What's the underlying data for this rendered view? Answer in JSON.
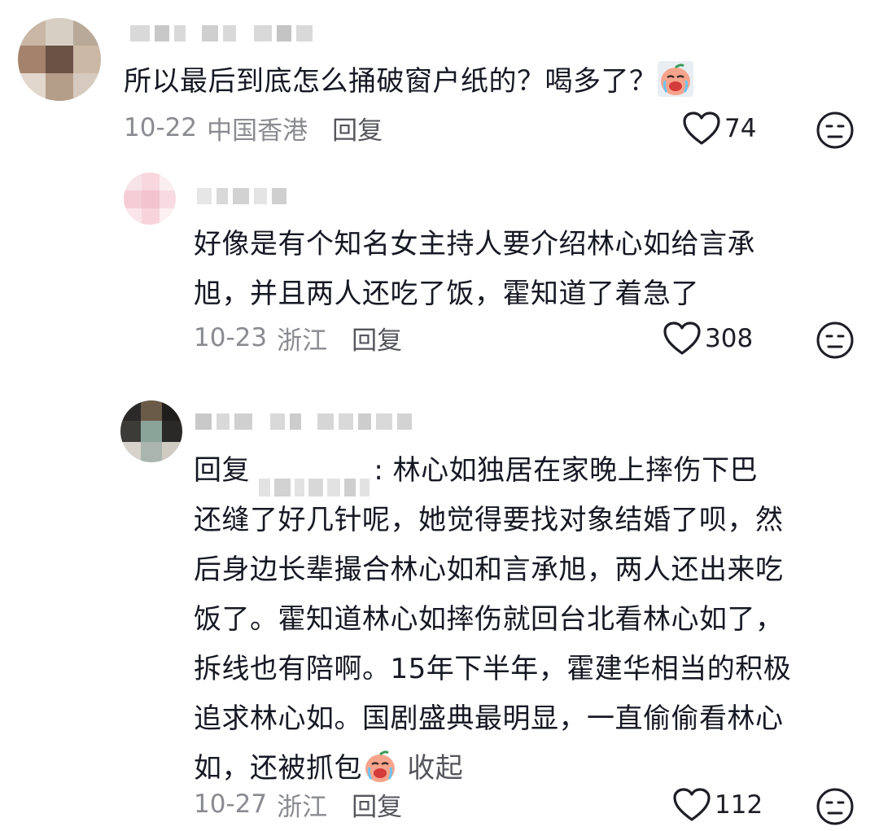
{
  "comments": [
    {
      "text": "所以最后到底怎么捅破窗户纸的？喝多了？",
      "emoji": "crying-face",
      "date": "10-22",
      "location": "中国香港",
      "reply_label": "回复",
      "likes": "74"
    },
    {
      "text_line1": "好像是有个知名女主持人要介绍林心如给言承",
      "text_line2": "旭，并且两人还吃了饭，霍知道了着急了",
      "date": "10-23",
      "location": "浙江",
      "reply_label": "回复",
      "likes": "308"
    },
    {
      "reply_prefix": "回复",
      "line1_after": ": 林心如独居在家晚上摔伤下巴",
      "line2": "还缝了好几针呢，她觉得要找对象结婚了呗，然",
      "line3": "后身边长辈撮合林心如和言承旭，两人还出来吃",
      "line4": "饭了。霍知道林心如摔伤就回台北看林心如了，",
      "line5": "拆线也有陪啊。15年下半年，霍建华相当的积极",
      "line6": "追求林心如。国剧盛典最明显，一直偷偷看林心",
      "line7": "如，还被抓包",
      "emoji": "crying-face",
      "collapse_label": "收起",
      "date": "10-27",
      "location": "浙江",
      "reply_label": "回复",
      "likes": "112"
    }
  ],
  "colors": {
    "text": "#161823",
    "meta": "#8a8b91",
    "action": "#55565c"
  }
}
